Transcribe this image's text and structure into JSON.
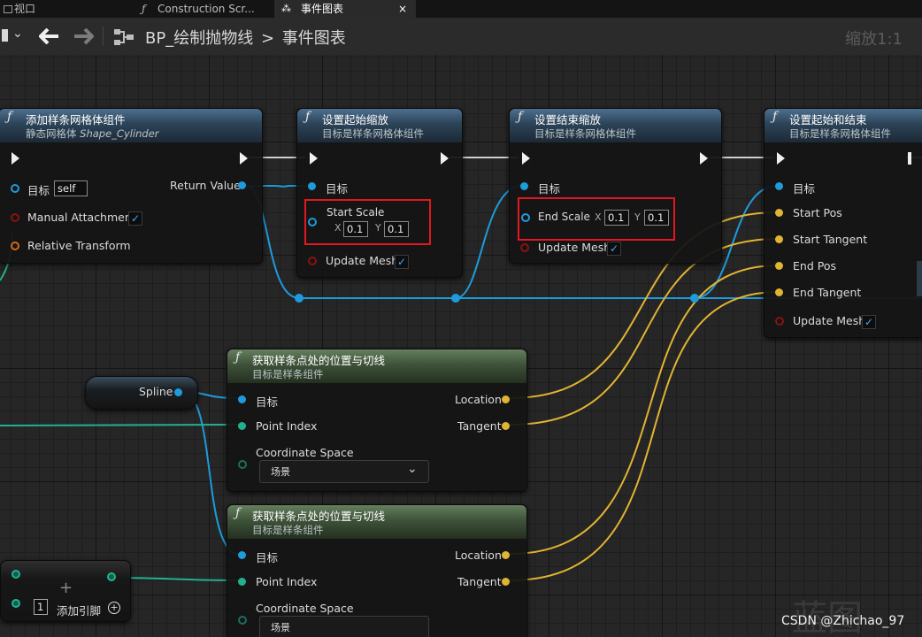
{
  "tabs": [
    {
      "label": "视口"
    },
    {
      "label": "Construction Scr..."
    },
    {
      "label": "事件图表",
      "close": "×"
    }
  ],
  "toolbar": {
    "breadcrumb_bp": "BP_绘制抛物线",
    "separator": ">",
    "breadcrumb_graph": "事件图表",
    "zoom": "缩放1:1"
  },
  "nodes": {
    "add_spline_mesh": {
      "title": "添加样条网格体组件",
      "subtitle_prefix": "静态网格体",
      "subtitle_mesh": "Shape_Cylinder",
      "target_label": "目标",
      "target_value": "self",
      "manual_attachment": "Manual Attachment",
      "manual_attachment_checked": true,
      "relative_transform": "Relative Transform",
      "return_value": "Return Value"
    },
    "set_start_scale": {
      "title": "设置起始缩放",
      "subtitle": "目标是样条网格体组件",
      "target_label": "目标",
      "start_scale": "Start Scale",
      "x_label": "X",
      "x_value": "0.1",
      "y_label": "Y",
      "y_value": "0.1",
      "update_mesh": "Update Mesh",
      "update_mesh_checked": true
    },
    "set_end_scale": {
      "title": "设置结束缩放",
      "subtitle": "目标是样条网格体组件",
      "target_label": "目标",
      "end_scale": "End Scale",
      "x_label": "X",
      "x_value": "0.1",
      "y_label": "Y",
      "y_value": "0.1",
      "update_mesh": "Update Mesh",
      "update_mesh_checked": true
    },
    "set_start_end": {
      "title": "设置起始和结束",
      "subtitle": "目标是样条网格体组件",
      "target_label": "目标",
      "start_pos": "Start Pos",
      "start_tangent": "Start Tangent",
      "end_pos": "End Pos",
      "end_tangent": "End Tangent",
      "update_mesh": "Update Mesh",
      "update_mesh_checked": true
    },
    "spline_var": {
      "label": "Spline"
    },
    "get_point_1": {
      "title": "获取样条点处的位置与切线",
      "subtitle": "目标是样条组件",
      "target_label": "目标",
      "point_index": "Point Index",
      "coordinate_space": "Coordinate Space",
      "coordinate_value": "场景",
      "location": "Location",
      "tangent": "Tangent"
    },
    "get_point_2": {
      "title": "获取样条点处的位置与切线",
      "subtitle": "目标是样条组件",
      "target_label": "目标",
      "point_index": "Point Index",
      "coordinate_space": "Coordinate Space",
      "coordinate_value": "场景",
      "location": "Location",
      "tangent": "Tangent"
    },
    "add_pin": {
      "index": "1",
      "label": "添加引脚"
    }
  },
  "watermark": {
    "text": "CSDN @Zhichao_97",
    "faint": "蓝图"
  },
  "colors": {
    "wire_blue": "#1e9bdc",
    "wire_yellow": "#e2b432",
    "wire_green": "#22b190",
    "exec_white": "#f0f0f0",
    "highlight_red": "#e2171f"
  }
}
